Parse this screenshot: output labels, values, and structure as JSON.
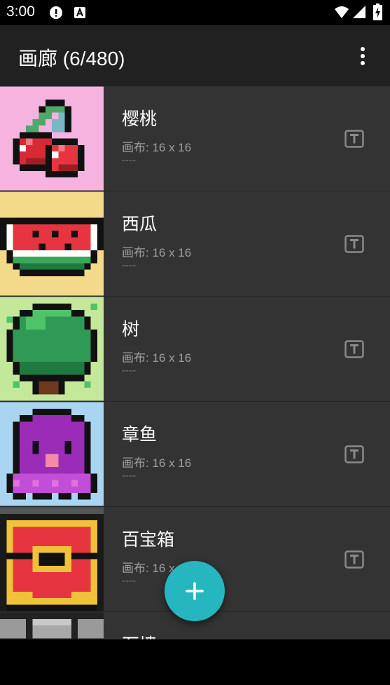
{
  "status": {
    "time": "3:00"
  },
  "appbar": {
    "title": "画廊 (6/480)"
  },
  "items": [
    {
      "name": "樱桃",
      "canvas": "画布: 16 x 16",
      "info": "----",
      "bg": "#f7b3df"
    },
    {
      "name": "西瓜",
      "canvas": "画布: 16 x 16",
      "info": "----",
      "bg": "#f3d98a"
    },
    {
      "name": "树",
      "canvas": "画布: 16 x 16",
      "info": "----",
      "bg": "#c4e89a"
    },
    {
      "name": "章鱼",
      "canvas": "画布: 16 x 16",
      "info": "----",
      "bg": "#a9d5f0"
    },
    {
      "name": "百宝箱",
      "canvas": "画布: 16 x 16",
      "info": "----",
      "bg": "#1a1a1a"
    },
    {
      "name": "石墙",
      "canvas": "",
      "info": "",
      "bg": "#222222"
    }
  ],
  "fab": {
    "icon": "plus-icon"
  },
  "colors": {
    "accent": "#26b6bf",
    "appbar": "#212121",
    "list_bg": "#333333"
  }
}
